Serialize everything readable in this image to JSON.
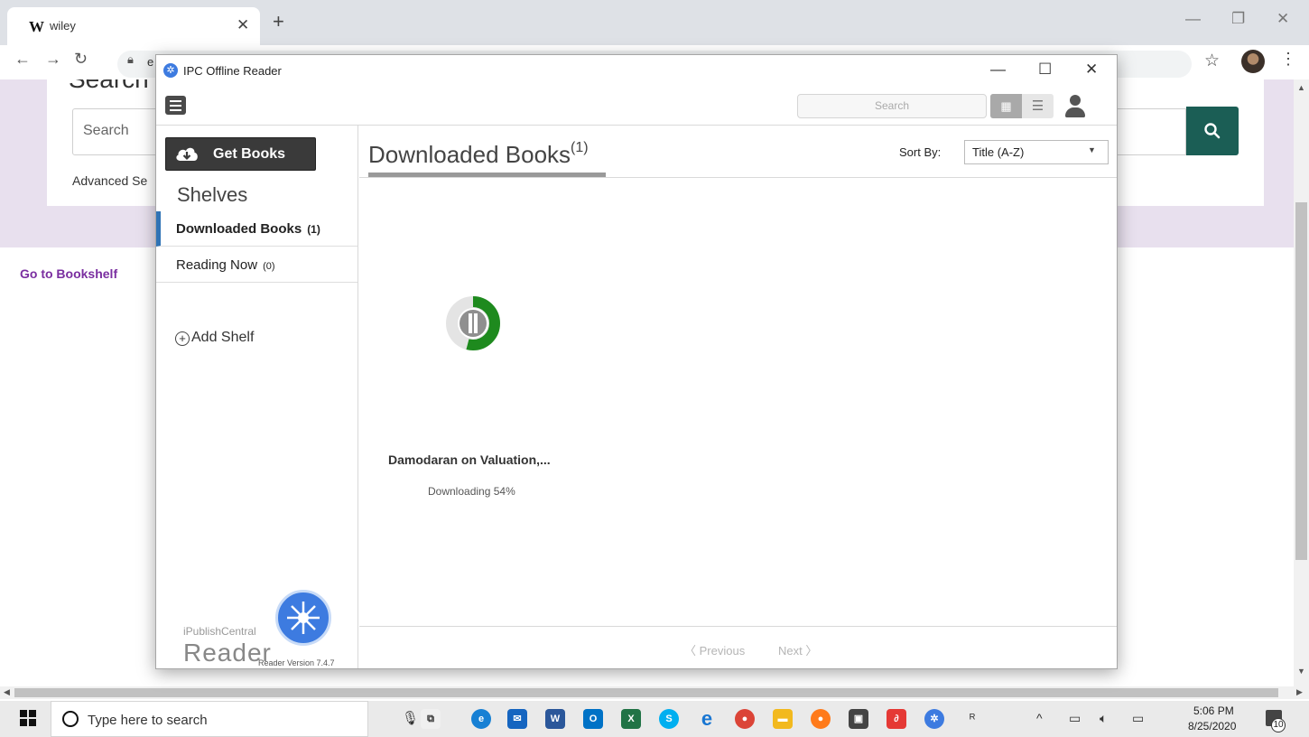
{
  "browser": {
    "tab_favicon": "W",
    "tab_title": "wiley",
    "address_partial": "e",
    "accent": "#1b5e55"
  },
  "webpage": {
    "search_heading": "Search",
    "search_placeholder": "Search",
    "advanced_link": "Advanced Se",
    "bookshelf_link": "Go to Bookshelf"
  },
  "reader": {
    "window_title": "IPC Offline Reader",
    "search_placeholder": "Search",
    "get_books_label": "Get Books",
    "shelves_heading": "Shelves",
    "shelves": [
      {
        "name": "Downloaded Books",
        "count": "(1)",
        "active": true
      },
      {
        "name": "Reading Now",
        "count": "(0)",
        "active": false
      }
    ],
    "add_shelf_label": "Add Shelf",
    "brand_small": "iPublishCentral",
    "brand_large": "Reader",
    "version": "Reader Version 7.4.7",
    "content_title": "Downloaded Books",
    "content_count": "(1)",
    "sort_label": "Sort By:",
    "sort_value": "Title (A-Z)",
    "books": [
      {
        "title": "Damodaran on Valuation,...",
        "status": "Downloading 54%",
        "progress_percent": 54
      }
    ],
    "prev_label": "Previous",
    "next_label": "Next",
    "accent_blue": "#2f73b5",
    "progress_green": "#1e8a1e"
  },
  "taskbar": {
    "search_placeholder": "Type here to search",
    "clock_time": "5:06 PM",
    "clock_date": "8/25/2020",
    "notification_count": "10"
  }
}
